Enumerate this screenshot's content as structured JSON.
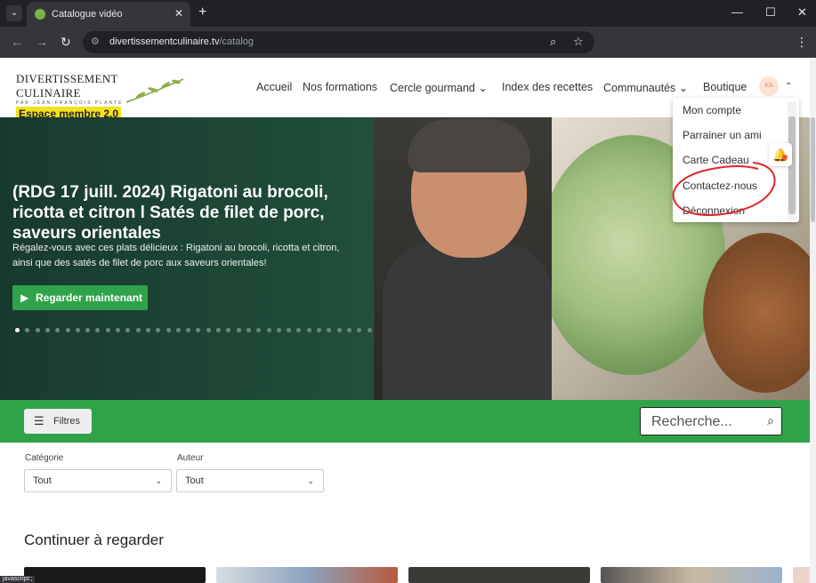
{
  "browser": {
    "tab_title": "Catalogue vidéo",
    "tab_close": "✕",
    "new_tab": "+",
    "url_domain": "divertissementculinaire.tv",
    "url_path": "/catalog",
    "status_text": "javascript:;"
  },
  "header": {
    "logo_title": "DIVERTISSEMENT CULINAIRE",
    "logo_subtitle": "PAR JEAN-FRANÇOIS PLANTE",
    "logo_badge": "Espace membre 2.0",
    "nav": {
      "home": "Accueil",
      "courses": "Nos formations",
      "circle": "Cercle gourmand",
      "recipes": "Index des recettes",
      "communities": "Communautés",
      "shop": "Boutique"
    },
    "avatar_initials": "KA"
  },
  "account_menu": {
    "items": [
      "Mon compte",
      "Parrainer un ami",
      "Carte Cadeau",
      "Contactez-nous",
      "Déconnexion"
    ]
  },
  "hero": {
    "title": "(RDG 17 juill. 2024) Rigatoni au brocoli, ricotta et citron l Satés de filet de porc, saveurs orientales",
    "description": "Régalez-vous avec ces plats délicieux : Rigatoni au brocoli, ricotta et citron, ainsi que des satés de filet de porc aux saveurs orientales!",
    "watch_label": "Regarder maintenant",
    "slide_count": 36,
    "active_slide": 1
  },
  "filters": {
    "button_label": "Filtres",
    "search_placeholder": "Recherche...",
    "category_label": "Catégorie",
    "category_value": "Tout",
    "author_label": "Auteur",
    "author_value": "Tout"
  },
  "continue_section": {
    "title": "Continuer à regarder"
  },
  "colors": {
    "brand_green": "#2fa34a",
    "annotation_red": "#e0252b",
    "logo_yellow": "#f2e21c"
  }
}
